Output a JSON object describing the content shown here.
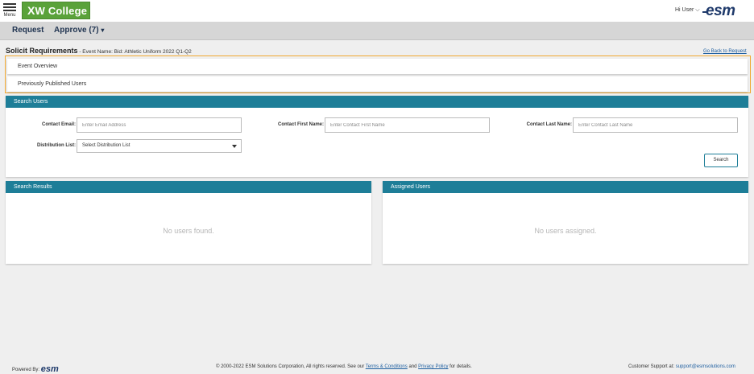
{
  "header": {
    "menu_label": "Menu",
    "logo_text": "W College",
    "logo_mark": "X",
    "user_greeting": "Hi User",
    "user_caret": "⌵",
    "brand_logo": "esm"
  },
  "nav": {
    "request_label": "Request",
    "approve_label": "Approve (7)",
    "approve_caret": "▾"
  },
  "page": {
    "title": "Solicit Requirements",
    "subtitle": " - Event Name: Bid: Athletic Uniform 2022 Q1-Q2",
    "back_link": "Go Back to Request"
  },
  "accordion": {
    "items": [
      {
        "label": "Event Overview"
      },
      {
        "label": "Previously Published Users"
      }
    ]
  },
  "search_users": {
    "header": "Search Users",
    "contact_email_label": "Contact Email:",
    "contact_email_placeholder": "Enter Email Address",
    "first_name_label": "Contact First Name:",
    "first_name_placeholder": "Enter Contact First Name",
    "last_name_label": "Contact Last Name:",
    "last_name_placeholder": "Enter Contact Last Name",
    "distribution_label": "Distribution List:",
    "distribution_value": "Select Distribution List",
    "search_button": "Search"
  },
  "search_results": {
    "header": "Search Results",
    "empty_message": "No users found."
  },
  "assigned_users": {
    "header": "Assigned Users",
    "empty_message": "No users assigned."
  },
  "footer": {
    "powered_by": "Powered By:",
    "powered_logo": "esm",
    "copyright_prefix": "© 2000-2022 ESM Solutions Corporation, All rights reserved. See our ",
    "terms_link": "Terms & Conditions",
    "and_text": " and ",
    "privacy_link": "Privacy Policy",
    "copyright_suffix": " for details.",
    "support_prefix": "Customer Support at: ",
    "support_email": "support@esmsolutions.com"
  },
  "colors": {
    "panel_header": "#1e7e98",
    "logo_green": "#5aa23a",
    "highlight_border": "#f0a830",
    "brand_navy": "#1f3a6b"
  }
}
